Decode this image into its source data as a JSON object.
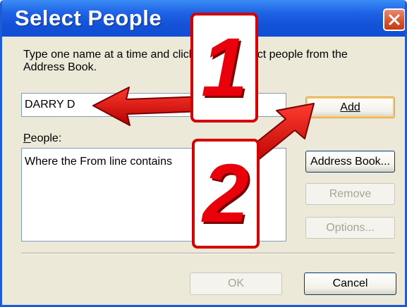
{
  "window": {
    "title": "Select People"
  },
  "instructions": {
    "text": "Type one name at a time and click Add, or select people from the Address Book."
  },
  "name_input": {
    "value": "DARRY D"
  },
  "people": {
    "label": "People:",
    "entries": [
      "Where the From line contains"
    ]
  },
  "buttons": {
    "add": "Add",
    "address_book": "Address Book...",
    "remove": "Remove",
    "options": "Options...",
    "ok": "OK",
    "cancel": "Cancel"
  },
  "annotations": {
    "step1": "1",
    "step2": "2",
    "color": "#e8000b"
  },
  "colors": {
    "titlebar": "#1f62e6",
    "close": "#d5532e",
    "dialog_bg": "#ece9d8"
  }
}
